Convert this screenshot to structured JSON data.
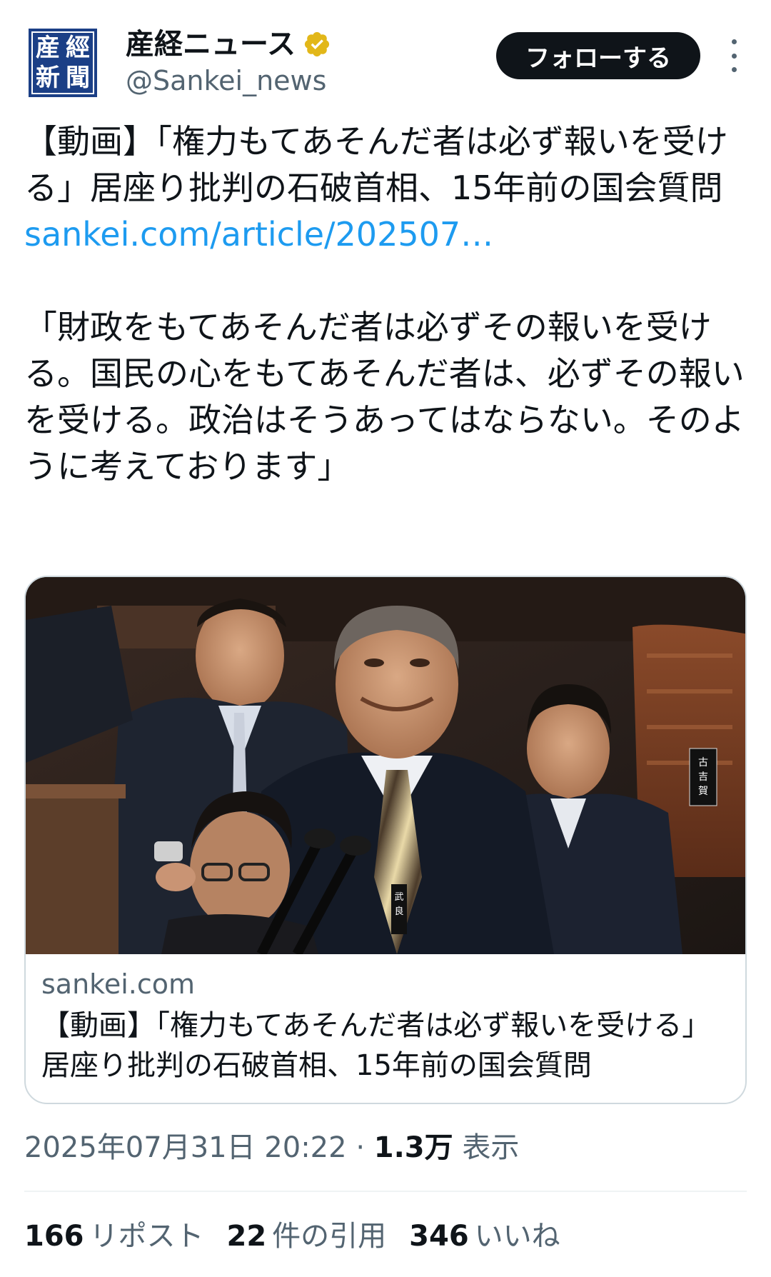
{
  "account": {
    "display_name": "産経ニュース",
    "handle": "@Sankei_news",
    "avatar_chars": [
      "産",
      "經",
      "新",
      "聞"
    ],
    "verified_color": "#e2b719"
  },
  "actions": {
    "follow_label": "フォローする"
  },
  "tweet": {
    "headline": "【動画】「権力もてあそんだ者は必ず報いを受ける」居座り批判の石破首相、15年前の国会質問",
    "link": "sankei.com/article/202507…",
    "quote": "「財政をもてあそんだ者は必ずその報いを受ける。国民の心をもてあそんだ者は、必ずその報いを受ける。政治はそうあってはならない。そのように考えております」"
  },
  "card": {
    "domain": "sankei.com",
    "title": "【動画】「権力もてあそんだ者は必ず報いを受ける」居座り批判の石破首相、15年前の国会質問",
    "image_placard_text": "武良",
    "nameplate_text": "古吉賀"
  },
  "meta": {
    "timestamp": "2025年07月31日 20:22",
    "separator": "·",
    "views_count": "1.3万",
    "views_label": "表示"
  },
  "stats": {
    "reposts_count": "166",
    "reposts_label": "リポスト",
    "quotes_count": "22",
    "quotes_label": "件の引用",
    "likes_count": "346",
    "likes_label": "いいね"
  },
  "colors": {
    "text": "#0f1419",
    "secondary": "#536471",
    "link": "#1d9bf0",
    "border": "#cfd9de"
  }
}
